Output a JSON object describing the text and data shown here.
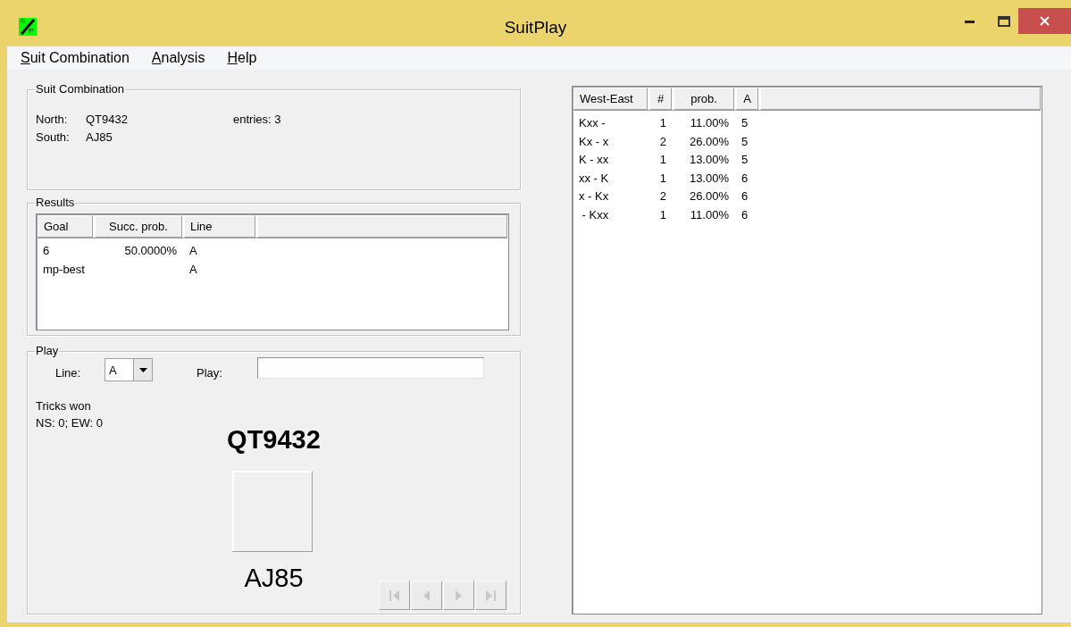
{
  "window": {
    "title": "SuitPlay",
    "app_icon": {
      "top": "S",
      "bottom": "P"
    }
  },
  "menu": [
    {
      "label": "Suit Combination"
    },
    {
      "label": "Analysis"
    },
    {
      "label": "Help"
    }
  ],
  "suit_combination": {
    "title": "Suit Combination",
    "north_label": "North:",
    "north": "QT9432",
    "south_label": "South:",
    "south": "AJ85",
    "entries": "entries: 3"
  },
  "results": {
    "title": "Results",
    "columns": [
      "Goal",
      "Succ. prob.",
      "Line"
    ],
    "rows": [
      [
        "6",
        "50.0000%",
        "A"
      ],
      [
        "mp-best",
        "",
        "A"
      ]
    ]
  },
  "play": {
    "title": "Play",
    "line_label": "Line:",
    "line_value": "A",
    "play_label": "Play:",
    "tricks_title": "Tricks won",
    "tricks": "NS: 0; EW: 0",
    "north_hand": "QT9432",
    "south_hand": "AJ85",
    "nav_buttons": [
      {
        "kind": "first",
        "disabled": true
      },
      {
        "kind": "prev",
        "disabled": true
      },
      {
        "kind": "next",
        "disabled": true
      },
      {
        "kind": "last",
        "disabled": true
      }
    ]
  },
  "distribution": {
    "columns": [
      "West-East",
      "#",
      "prob.",
      "A"
    ],
    "rows": [
      [
        "Kxx -",
        "1",
        "11.00%",
        "5"
      ],
      [
        "Kx - x",
        "2",
        "26.00%",
        "5"
      ],
      [
        "K - xx",
        "1",
        "13.00%",
        "5"
      ],
      [
        "xx - K",
        "1",
        "13.00%",
        "6"
      ],
      [
        "x - Kx",
        "2",
        "26.00%",
        "6"
      ],
      [
        " - Kxx",
        "1",
        "11.00%",
        "6"
      ]
    ]
  }
}
